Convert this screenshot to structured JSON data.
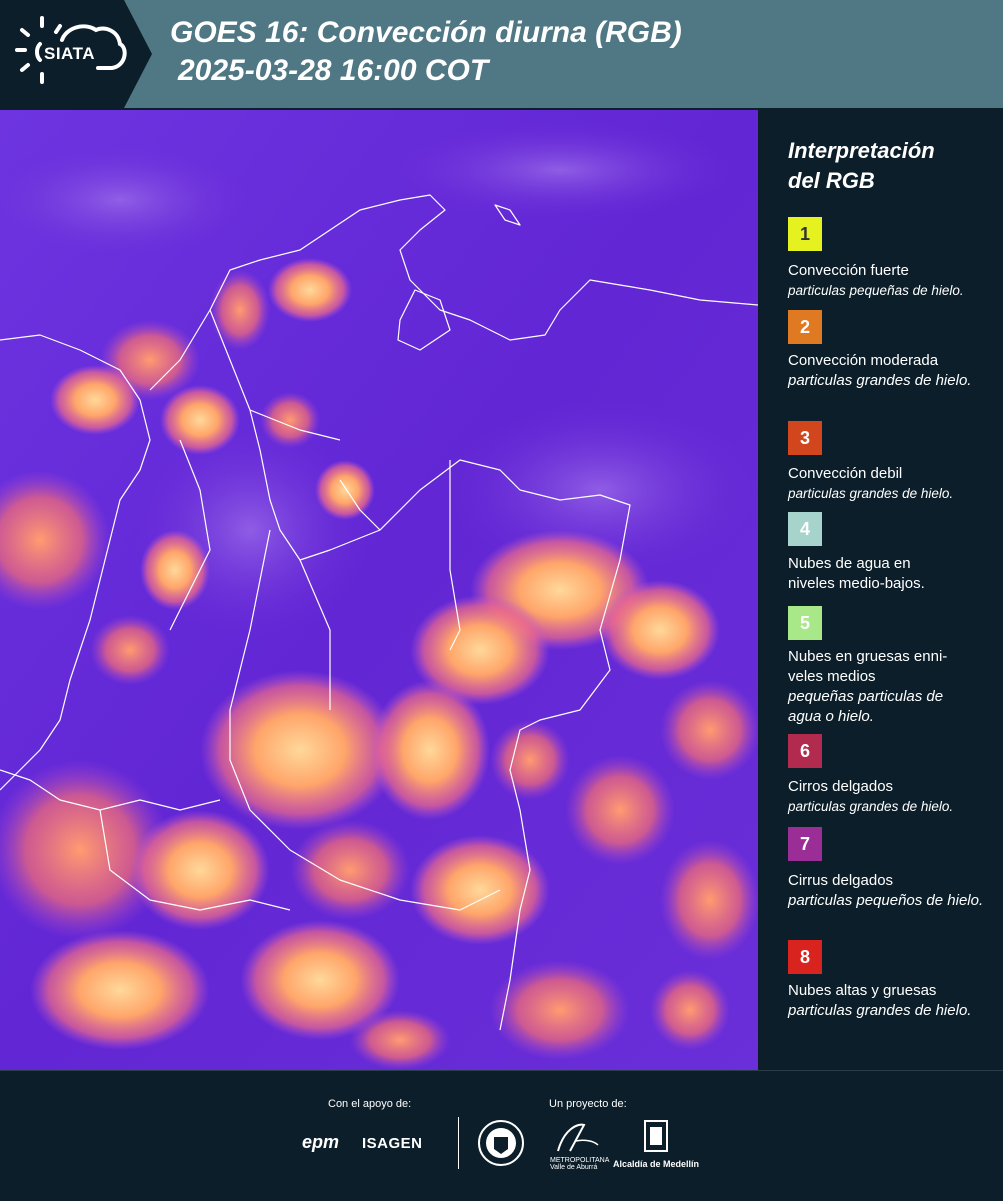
{
  "header": {
    "logo_text": "SIATA",
    "title_line1": "GOES 16: Convección diurna (RGB)",
    "title_line2": "2025-03-28 16:00 COT"
  },
  "legend": {
    "title_line1": "Interpretación",
    "title_line2": "del RGB",
    "items": [
      {
        "number": "1",
        "color": "#e6f21f",
        "text_color": "#333333",
        "label": "Convección fuerte",
        "sub": "particulas pequeñas de hielo."
      },
      {
        "number": "2",
        "color": "#e07a22",
        "text_color": "#ffffff",
        "label": "Convección moderada",
        "sub": "particulas grandes de hielo."
      },
      {
        "number": "3",
        "color": "#d2461e",
        "text_color": "#ffffff",
        "label": "Convección debil",
        "sub": "particulas grandes de hielo."
      },
      {
        "number": "4",
        "color": "#a6d4cc",
        "text_color": "#ffffff",
        "label": "Nubes de agua en niveles medio-bajos.",
        "sub": ""
      },
      {
        "number": "5",
        "color": "#a8e888",
        "text_color": "#ffffff",
        "label": "Nubes en gruesas enni-veles medios",
        "sub": "pequeñas particulas de agua o hielo."
      },
      {
        "number": "6",
        "color": "#b22b4e",
        "text_color": "#ffffff",
        "label": "Cirros delgados",
        "sub": "particulas grandes de hielo."
      },
      {
        "number": "7",
        "color": "#9b2d96",
        "text_color": "#ffffff",
        "label": "Cirrus delgados",
        "sub": "particulas pequeños de hielo."
      },
      {
        "number": "8",
        "color": "#d8231e",
        "text_color": "#ffffff",
        "label": "Nubes altas y gruesas",
        "sub": "particulas grandes de hielo."
      }
    ]
  },
  "footer": {
    "support_label": "Con el apoyo de:",
    "project_label": "Un proyecto de:",
    "epm": "epm",
    "isagen": "ISAGEN",
    "area_name": "METROPOLITANA Valle de Aburrá",
    "alcaldia": "Alcaldía de Medellín"
  }
}
